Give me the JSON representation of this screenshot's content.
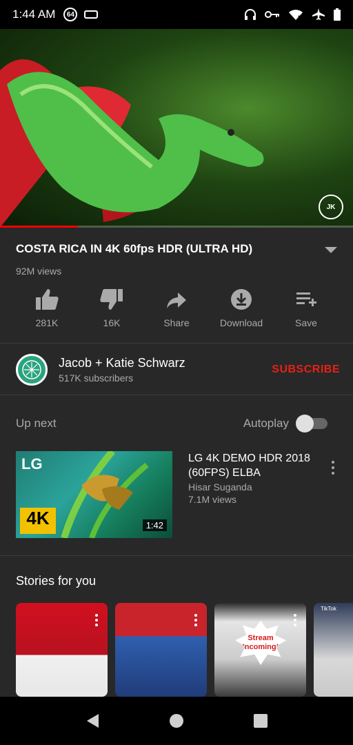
{
  "status_bar": {
    "time": "1:44 AM",
    "badge": "64"
  },
  "video": {
    "watermark": "JK",
    "progress_fraction": 0.22
  },
  "title": "COSTA RICA IN 4K 60fps HDR (ULTRA HD)",
  "views": "92M views",
  "actions": [
    {
      "label": "281K",
      "icon": "thumbs-up-icon"
    },
    {
      "label": "16K",
      "icon": "thumbs-down-icon"
    },
    {
      "label": "Share",
      "icon": "share-icon"
    },
    {
      "label": "Download",
      "icon": "download-icon"
    },
    {
      "label": "Save",
      "icon": "save-playlist-icon"
    }
  ],
  "channel": {
    "name": "Jacob + Katie Schwarz",
    "subscribers": "517K subscribers",
    "subscribe_label": "SUBSCRIBE"
  },
  "upnext": {
    "label": "Up next",
    "autoplay_label": "Autoplay",
    "autoplay_on": false
  },
  "recommended": {
    "title": "LG 4K DEMO HDR 2018 (60FPS) ELBA",
    "author": "Hisar Suganda",
    "views": "7.1M views",
    "duration": "1:42",
    "thumb_logo": "LG",
    "thumb_badge": "4K"
  },
  "stories": {
    "title": "Stories for you",
    "story3_text": "Stream Incoming!",
    "story4_text": "TikTok"
  },
  "colors": {
    "background": "#282828",
    "accent": "#e62117"
  }
}
